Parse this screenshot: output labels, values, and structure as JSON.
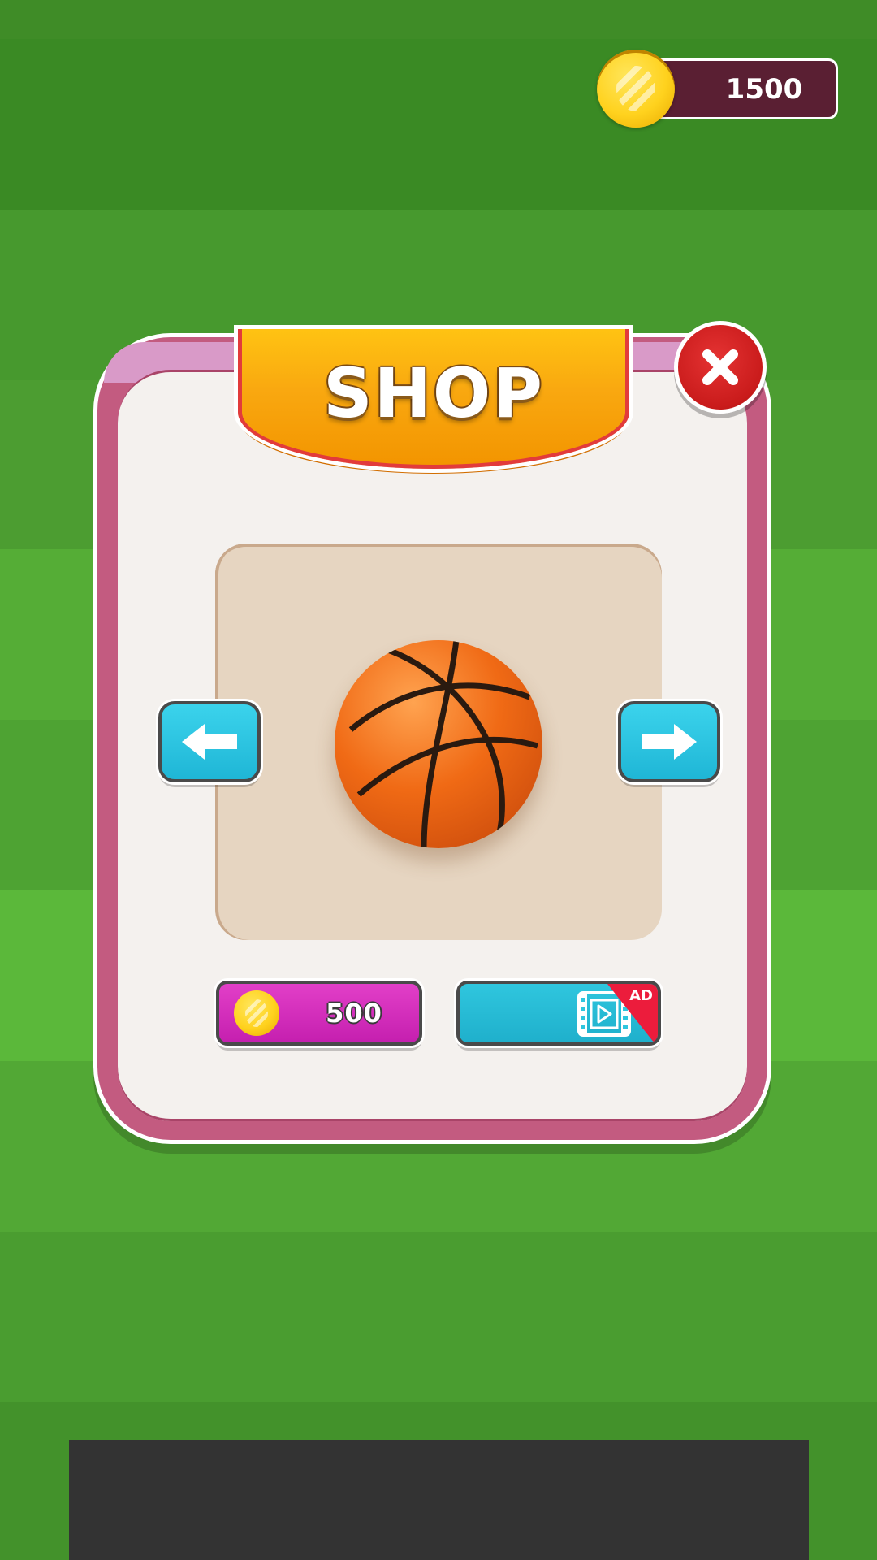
{
  "header": {
    "coins": "1500",
    "coin_icon": "coin-icon"
  },
  "shop": {
    "title": "SHOP",
    "close_icon": "close-icon",
    "item": {
      "name_icon": "basketball-icon"
    },
    "nav": {
      "prev_icon": "arrow-left-icon",
      "next_icon": "arrow-right-icon"
    },
    "buy_button": {
      "price": "500",
      "icon": "coin-icon"
    },
    "ad_button": {
      "badge": "AD",
      "icon": "video-film-icon"
    }
  },
  "colors": {
    "grass": "#4a9a2e",
    "panel_border": "#c35b80",
    "banner": "#f9a810",
    "close": "#c91b1b",
    "arrow": "#1fb6d6",
    "buy": "#c51faf",
    "ad": "#1fb0cc",
    "ad_badge": "#ec1c3c"
  }
}
